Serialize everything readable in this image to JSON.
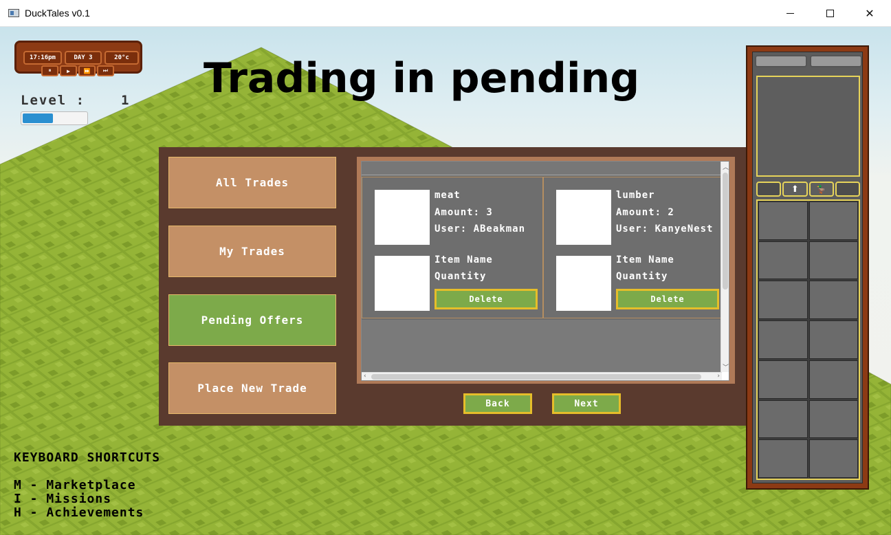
{
  "window": {
    "title": "DuckTales v0.1",
    "min_icon": "minimize-icon",
    "max_icon": "maximize-icon",
    "close_icon": "close-icon",
    "close_glyph": "✕"
  },
  "hud": {
    "time": "17:16pm",
    "day": "DAY 3",
    "temp": "20°c",
    "controls": [
      {
        "name": "pause-icon",
        "glyph": "⏸"
      },
      {
        "name": "play-icon",
        "glyph": "▶"
      },
      {
        "name": "fast-forward-icon",
        "glyph": "⏩"
      },
      {
        "name": "fastest-forward-icon",
        "glyph": "⏭"
      }
    ],
    "level_label": "Level :",
    "level_value": "1",
    "level_progress": 0.46
  },
  "page_title": "Trading in pending",
  "sidebar": {
    "items": [
      {
        "label": "All Trades",
        "active": false
      },
      {
        "label": "My Trades",
        "active": false
      },
      {
        "label": "Pending Offers",
        "active": true
      },
      {
        "label": "Place New Trade",
        "active": false
      }
    ]
  },
  "trades": [
    {
      "item": "meat",
      "amount": "Amount: 3",
      "user": "User: ABeakman",
      "item_name_label": "Item Name",
      "quantity_label": "Quantity",
      "delete_label": "Delete"
    },
    {
      "item": "lumber",
      "amount": "Amount: 2",
      "user": "User: KanyeNest",
      "item_name_label": "Item Name",
      "quantity_label": "Quantity",
      "delete_label": "Delete"
    }
  ],
  "nav": {
    "back_label": "Back",
    "next_label": "Next"
  },
  "shortcuts": {
    "title": "KEYBOARD SHORTCUTS",
    "items": [
      "M - Marketplace",
      "I - Missions",
      "H - Achievements"
    ]
  },
  "inventory": {
    "tabs": [
      {
        "name": "inventory-tab-empty",
        "glyph": ""
      },
      {
        "name": "upload-icon",
        "glyph": "⬆"
      },
      {
        "name": "duck-icon",
        "glyph": "🦆"
      },
      {
        "name": "inventory-tab-empty-2",
        "glyph": ""
      }
    ],
    "slot_count": 14
  },
  "colors": {
    "accent_green": "#7daa4a",
    "button_brown": "#c49066",
    "panel_brown": "#5a3a2e",
    "highlight_yellow": "#e6be2a"
  }
}
